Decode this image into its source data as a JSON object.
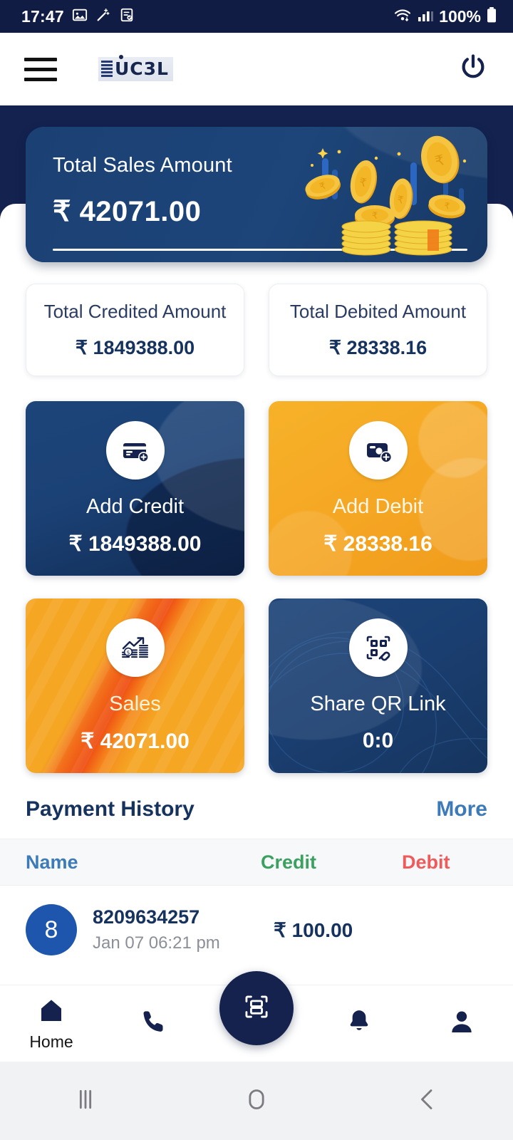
{
  "status_bar": {
    "time": "17:47",
    "battery_percent": "100%",
    "left_icons": [
      "image-icon",
      "magic-wand-icon",
      "document-check-icon"
    ],
    "right_icons": [
      "wifi-icon",
      "signal-icon",
      "battery-icon"
    ]
  },
  "app_bar": {
    "menu_icon": "hamburger-menu-icon",
    "logo_text": "UC3L",
    "power_icon": "power-icon"
  },
  "hero": {
    "title": "Total Sales Amount",
    "amount": "₹ 42071.00",
    "illustration": "falling-coins-illustration"
  },
  "summary": [
    {
      "label": "Total Credited Amount",
      "value": "₹ 1849388.00"
    },
    {
      "label": "Total Debited Amount",
      "value": "₹ 28338.16"
    }
  ],
  "tiles": [
    {
      "label": "Add Credit",
      "value": "₹ 1849388.00",
      "icon": "credit-card-plus-icon",
      "color": "#1b4175"
    },
    {
      "label": "Add Debit",
      "value": "₹ 28338.16",
      "icon": "debit-card-plus-icon",
      "color": "#f5a623"
    },
    {
      "label": "Sales",
      "value": "₹ 42071.00",
      "icon": "growth-chart-coins-icon",
      "color": "#f5a623"
    },
    {
      "label": "Share QR Link",
      "value": "0:0",
      "icon": "qr-link-icon",
      "color": "#1a3e70"
    }
  ],
  "payment_history": {
    "title": "Payment History",
    "more_label": "More",
    "columns": [
      "Name",
      "Credit",
      "Debit"
    ],
    "column_colors": {
      "name": "#3d7ab8",
      "credit": "#3ca060",
      "debit": "#ef5a5a"
    },
    "rows": [
      {
        "initial": "8",
        "name": "8209634257",
        "date": "Jan 07 06:21 pm",
        "credit": "₹ 100.00",
        "debit": ""
      }
    ]
  },
  "bottom_nav": {
    "items": [
      {
        "label": "Home",
        "icon": "home-icon",
        "active": true
      },
      {
        "label": "",
        "icon": "phone-icon",
        "active": false
      },
      {
        "label": "",
        "icon": "bell-icon",
        "active": false
      },
      {
        "label": "",
        "icon": "person-icon",
        "active": false
      }
    ],
    "fab_icon": "scan-icon"
  },
  "system_nav": {
    "recents_icon": "recents-icon",
    "home_icon": "home-circle-icon",
    "back_icon": "back-chevron-icon"
  }
}
